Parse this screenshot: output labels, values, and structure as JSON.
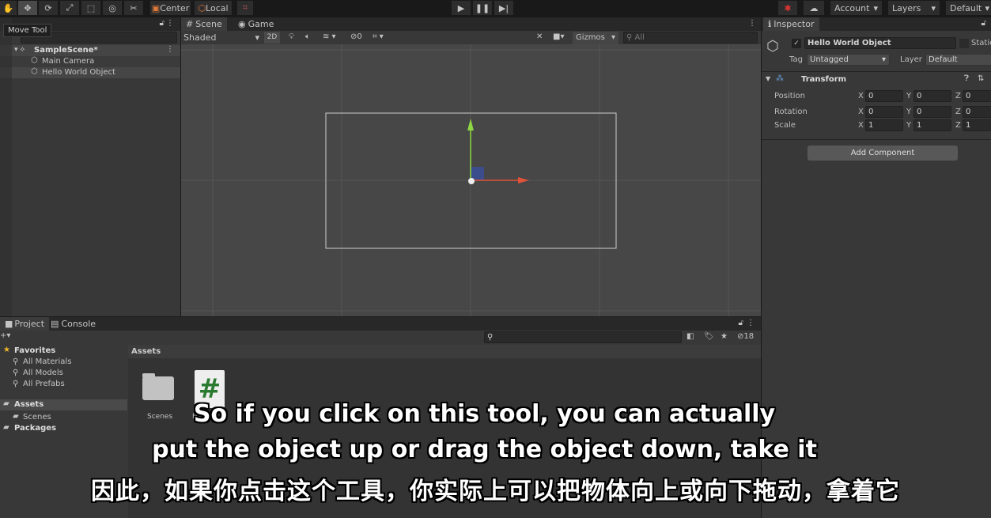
{
  "toolbar": {
    "tools": [
      "hand",
      "move",
      "rotate",
      "scale",
      "rect",
      "transform",
      "custom"
    ],
    "pivot": "Center",
    "space": "Local",
    "account": "Account",
    "layers": "Layers",
    "layout": "Default",
    "tooltip": "Move Tool"
  },
  "hierarchy": {
    "scene": "SampleScene*",
    "items": [
      "Main Camera",
      "Hello World Object"
    ]
  },
  "scene_view": {
    "tabs": [
      "Scene",
      "Game"
    ],
    "shading": "Shaded",
    "mode2d": "2D",
    "hidden_count": "0",
    "gizmos": "Gizmos",
    "search_placeholder": "All"
  },
  "inspector": {
    "tab": "Inspector",
    "object_name": "Hello World Object",
    "static": "Static",
    "tag_label": "Tag",
    "tag": "Untagged",
    "layer_label": "Layer",
    "layer": "Default",
    "component": "Transform",
    "rows": [
      {
        "label": "Position",
        "x": "0",
        "y": "0",
        "z": "0"
      },
      {
        "label": "Rotation",
        "x": "0",
        "y": "0",
        "z": "0"
      },
      {
        "label": "Scale",
        "x": "1",
        "y": "1",
        "z": "1"
      }
    ],
    "axes": [
      "X",
      "Y",
      "Z"
    ],
    "add_component": "Add Component"
  },
  "project": {
    "tabs": [
      "Project",
      "Console"
    ],
    "favorites": "Favorites",
    "fav_items": [
      "All Materials",
      "All Models",
      "All Prefabs"
    ],
    "assets": "Assets",
    "asset_children": [
      "Scenes"
    ],
    "packages": "Packages",
    "breadcrumb": "Assets",
    "hidden_count": "18",
    "files": [
      {
        "name": "Scenes",
        "type": "folder"
      },
      {
        "name": "Hello",
        "type": "script"
      }
    ]
  },
  "subtitles": {
    "en_line1": "So if you click on this tool, you can actually",
    "en_line2": "put the object up or drag the object down, take it",
    "zh": "因此，如果你点击这个工具，你实际上可以把物体向上或向下拖动，拿着它"
  }
}
